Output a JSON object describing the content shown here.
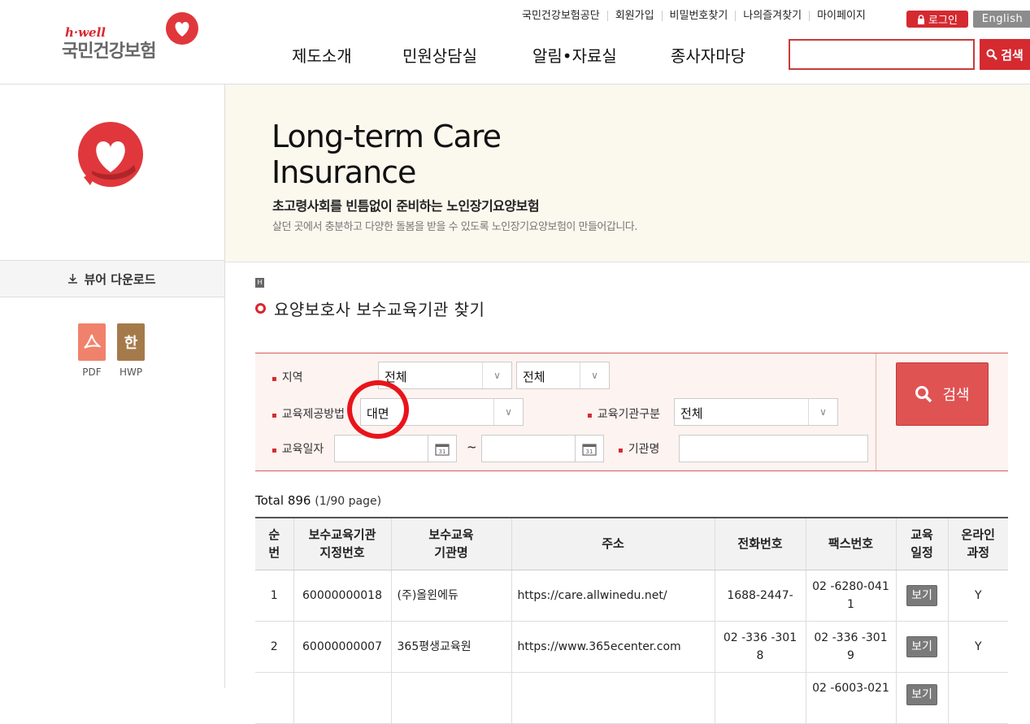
{
  "header": {
    "logo_sub": "h·well",
    "logo_main": "국민건강보험",
    "util_links": [
      "국민건강보험공단",
      "회원가입",
      "비밀번호찾기",
      "나의즐겨찾기",
      "마이페이지"
    ],
    "login_label": "로그인",
    "english_label": "English",
    "nav": [
      "제도소개",
      "민원상담실",
      "알림•자료실",
      "종사자마당"
    ],
    "search_placeholder": "",
    "search_label": "검색"
  },
  "sidebar": {
    "viewer_label": "뷰어 다운로드",
    "files": [
      {
        "icon": "pdf-icon",
        "label": "PDF",
        "color": "#f0826c"
      },
      {
        "icon": "hwp-icon",
        "label": "HWP",
        "glyph": "한",
        "color": "#a57a4a"
      }
    ]
  },
  "banner": {
    "title": "Long-term Care Insurance",
    "subtitle": "초고령사회를 빈틈없이 준비하는 노인장기요양보험",
    "description": "살던 곳에서 충분하고 다양한 돌봄을 받을 수 있도록 노인장기요양보험이 만들어갑니다."
  },
  "section": {
    "home_icon": "H",
    "title": "요양보호사 보수교육기관 찾기"
  },
  "form": {
    "region_label": "지역",
    "region1": "전체",
    "region2": "전체",
    "method_label": "교육제공방법",
    "method_value": "대면",
    "type_label": "교육기관구분",
    "type_value": "전체",
    "date_label": "교육일자",
    "date_from": "",
    "date_to": "",
    "tilde": "~",
    "name_label": "기관명",
    "name_value": "",
    "search_label": "검색"
  },
  "result": {
    "total_label": "Total",
    "total": "896",
    "page": "(1/90 page)"
  },
  "table": {
    "headers": [
      [
        "순",
        "번"
      ],
      [
        "보수교육기관",
        "지정번호"
      ],
      [
        "보수교육",
        "기관명"
      ],
      [
        "주소",
        ""
      ],
      [
        "전화번호",
        ""
      ],
      [
        "팩스번호",
        ""
      ],
      [
        "교육",
        "일정"
      ],
      [
        "온라인",
        "과정"
      ]
    ],
    "rows": [
      {
        "no": "1",
        "code": "60000000018",
        "name": "(주)올윈에듀",
        "address": "https://care.allwinedu.net/",
        "phone": [
          "1688-2447-",
          ""
        ],
        "fax": [
          "02 -6280-041",
          "1"
        ],
        "schedule": "보기",
        "online": "Y"
      },
      {
        "no": "2",
        "code": "60000000007",
        "name": "365평생교육원",
        "address": "https://www.365ecenter.com",
        "phone": [
          "02 -336 -301",
          "8"
        ],
        "fax": [
          "02 -336 -301",
          "9"
        ],
        "schedule": "보기",
        "online": "Y"
      },
      {
        "no": "",
        "code": "",
        "name": "",
        "address": "",
        "phone": [
          "",
          ""
        ],
        "fax": [
          "02 -6003-021",
          ""
        ],
        "schedule": "보기",
        "online": ""
      }
    ]
  },
  "colors": {
    "brand_red": "#d42a30",
    "banner_bg": "#fbf8ee",
    "form_bg": "#fdf3f0"
  }
}
